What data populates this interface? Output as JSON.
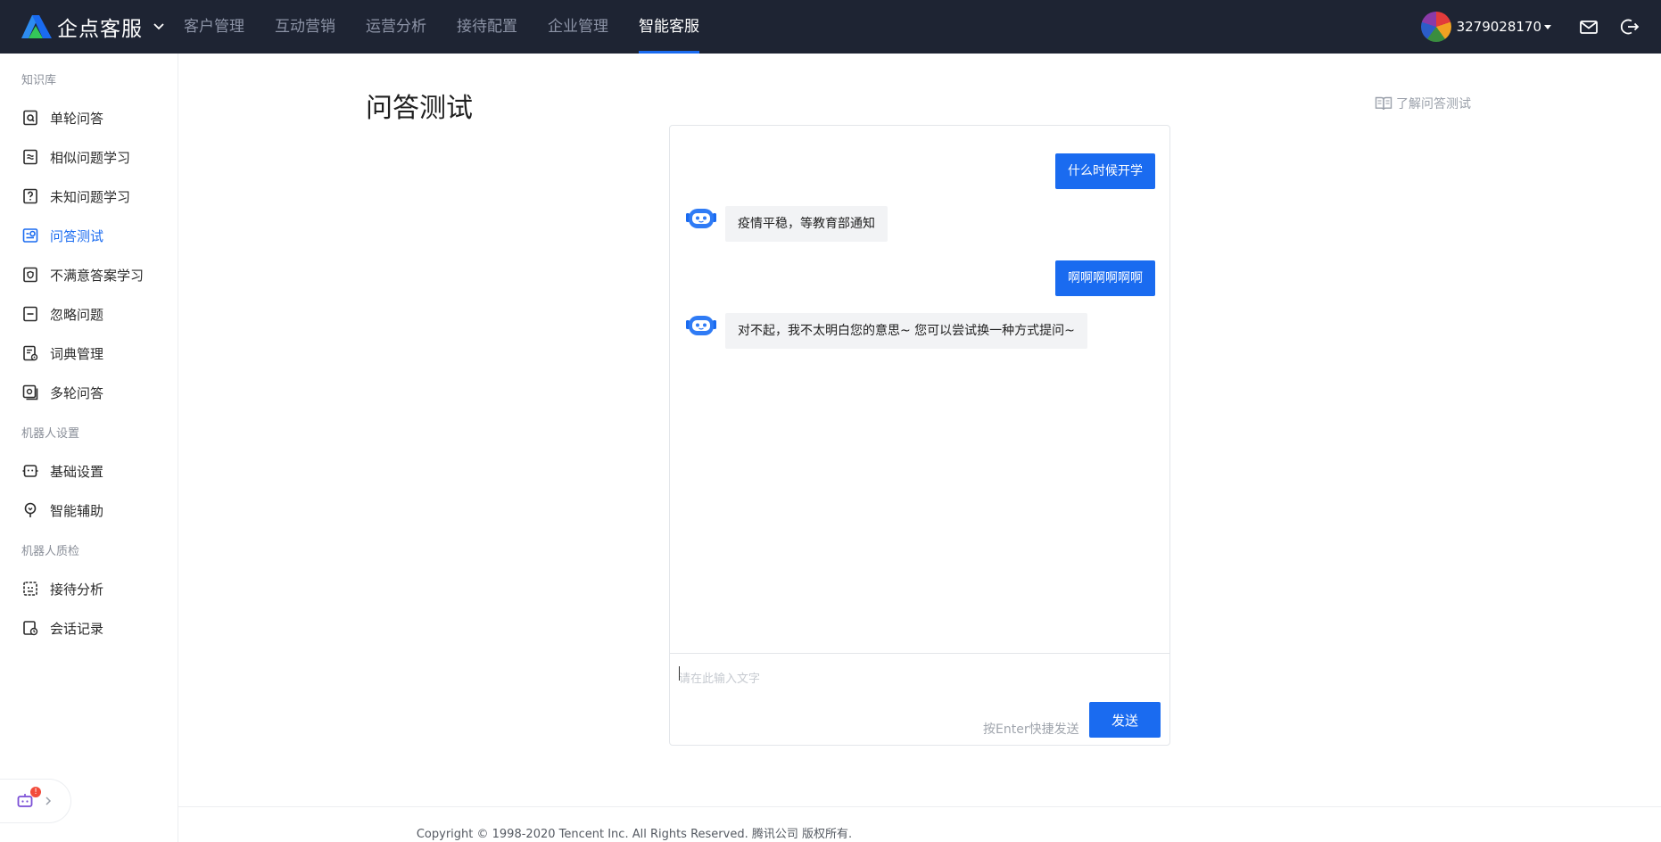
{
  "brand": {
    "name": "企点客服"
  },
  "nav": {
    "items": [
      {
        "label": "客户管理",
        "active": false
      },
      {
        "label": "互动营销",
        "active": false
      },
      {
        "label": "运营分析",
        "active": false
      },
      {
        "label": "接待配置",
        "active": false
      },
      {
        "label": "企业管理",
        "active": false
      },
      {
        "label": "智能客服",
        "active": true
      }
    ]
  },
  "account": {
    "id": "3279028170"
  },
  "sidebar": {
    "groups": [
      {
        "title": "知识库",
        "items": [
          {
            "label": "单轮问答",
            "icon": "single-qa-icon"
          },
          {
            "label": "相似问题学习",
            "icon": "similar-question-icon"
          },
          {
            "label": "未知问题学习",
            "icon": "unknown-question-icon"
          },
          {
            "label": "问答测试",
            "icon": "qa-test-icon",
            "active": true
          },
          {
            "label": "不满意答案学习",
            "icon": "unsatisfied-answer-icon"
          },
          {
            "label": "忽略问题",
            "icon": "ignore-question-icon"
          },
          {
            "label": "词典管理",
            "icon": "dictionary-icon"
          },
          {
            "label": "多轮问答",
            "icon": "multi-qa-icon"
          }
        ]
      },
      {
        "title": "机器人设置",
        "items": [
          {
            "label": "基础设置",
            "icon": "robot-settings-icon"
          },
          {
            "label": "智能辅助",
            "icon": "smart-assist-icon"
          }
        ]
      },
      {
        "title": "机器人质检",
        "items": [
          {
            "label": "接待分析",
            "icon": "reception-analysis-icon"
          },
          {
            "label": "会话记录",
            "icon": "session-record-icon"
          }
        ]
      }
    ]
  },
  "helper": {
    "badge": "!"
  },
  "main": {
    "title": "问答测试",
    "help_link": "了解问答测试"
  },
  "chat": {
    "messages": [
      {
        "role": "user",
        "text": "什么时候开学"
      },
      {
        "role": "bot",
        "text": "疫情平稳，等教育部通知"
      },
      {
        "role": "user",
        "text": "啊啊啊啊啊啊"
      },
      {
        "role": "bot",
        "text": "对不起，我不太明白您的意思~ 您可以尝试换一种方式提问~"
      }
    ],
    "input_placeholder": "请在此输入文字",
    "input_value": "",
    "enter_hint": "按Enter快捷发送",
    "send_label": "发送"
  },
  "colors": {
    "accent": "#1a6bf0",
    "topbar": "#1e2433"
  },
  "footer": {
    "copyright": "Copyright © 1998-2020 Tencent Inc. All Rights Reserved. 腾讯公司 版权所有."
  }
}
